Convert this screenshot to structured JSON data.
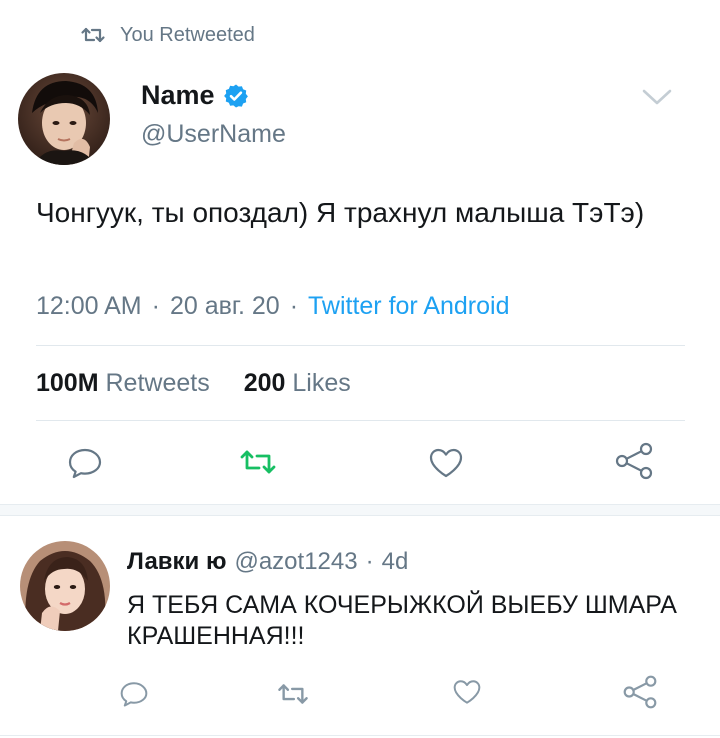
{
  "retweet_banner": {
    "text": "You Retweeted",
    "icon": "retweet-icon"
  },
  "tweet": {
    "author_name": "Name",
    "username": "@UserName",
    "verified": true,
    "text": "Чонгуук, ты опоздал) Я трахнул малыша ТэТэ)",
    "time": "12:00 AM",
    "date": "20 авг. 20",
    "separator": "·",
    "client": "Twitter for Android",
    "retweets_count": "100M",
    "retweets_label": "Retweets",
    "likes_count": "200",
    "likes_label": "Likes",
    "retweeted": true
  },
  "reply": {
    "author_name": "Лавки ю",
    "username": "@azot1243",
    "separator": "·",
    "age": "4d",
    "text": "Я ТЕБЯ САМА КОЧЕРЫЖКОЙ ВЫЕБУ ШМАРА КРАШЕННАЯ!!!"
  },
  "colors": {
    "text": "#14171a",
    "secondary": "#657786",
    "link": "#1da1f2",
    "retweet_active": "#17bf63",
    "divider": "#e1e8ed"
  }
}
